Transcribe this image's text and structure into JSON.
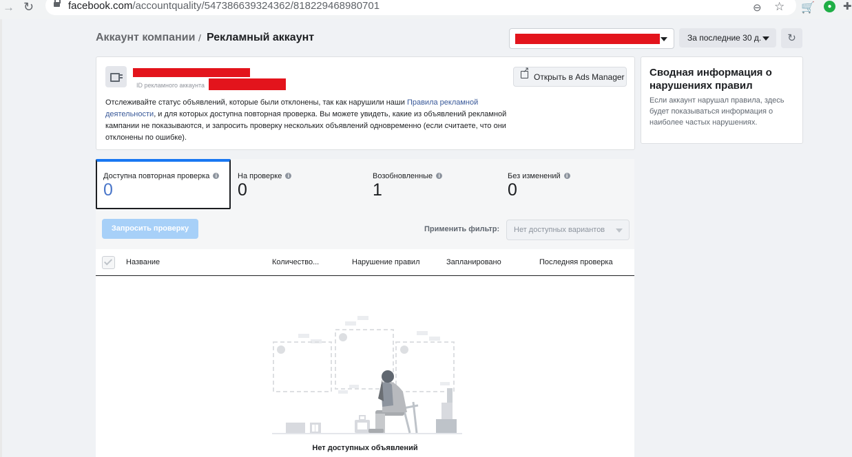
{
  "browser": {
    "url_domain": "facebook.com",
    "url_path": "/accountquality/547386639324362/818229468980701"
  },
  "header": {
    "breadcrumb_parent": "Аккаунт компании",
    "breadcrumb_separator": "/",
    "breadcrumb_current": "Рекламный аккаунт",
    "date_range": "За последние 30 д."
  },
  "account": {
    "id_label": "ID рекламного аккаунта",
    "open_ads_manager": "Открыть в Ads Manager",
    "desc_before_link": "Отслеживайте статус объявлений, которые были отклонены, так как нарушили наши ",
    "desc_link": "Правила рекламной деятельности",
    "desc_after_link": ", и для которых доступна повторная проверка. Вы можете увидеть, какие из объявлений рекламной кампании не показываются, и запросить проверку нескольких объявлений одновременно (если считаете, что они отклонены по ошибке)."
  },
  "summary": {
    "title": "Сводная информация о нарушениях правил",
    "text": "Если аккаунт нарушал правила, здесь будет показываться информация о наиболее частых нарушениях."
  },
  "tabs": [
    {
      "label": "Доступна повторная проверка",
      "count": "0"
    },
    {
      "label": "На проверке",
      "count": "0"
    },
    {
      "label": "Возобновленные",
      "count": "1"
    },
    {
      "label": "Без изменений",
      "count": "0"
    }
  ],
  "toolbar": {
    "request_review": "Запросить проверку",
    "filter_label": "Применить фильтр:",
    "filter_value": "Нет доступных вариантов"
  },
  "table": {
    "columns": [
      "Название",
      "Количество...",
      "Нарушение правил",
      "Запланировано",
      "Последняя проверка"
    ]
  },
  "empty_state": "Нет доступных объявлений",
  "colors": {
    "accent": "#1877f2",
    "redaction": "#e3141c",
    "link": "#385898",
    "disabled_button": "#a7d0f8"
  }
}
